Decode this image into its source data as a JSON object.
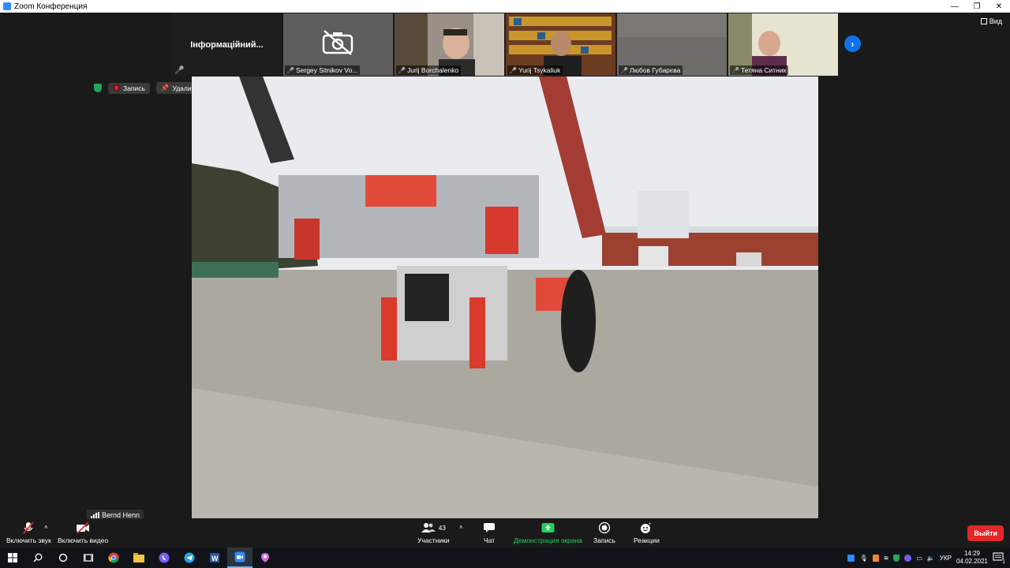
{
  "window": {
    "title": "Zoom Конференция"
  },
  "info_tile": {
    "label": "Інформаційний..."
  },
  "participants": [
    {
      "name": "Sergey Sitnikov Vo...",
      "video": false
    },
    {
      "name": "Jurij Borchalenko",
      "video": true
    },
    {
      "name": "Yurij Tsykaliuk",
      "video": true
    },
    {
      "name": "Любов Губарєва",
      "video": true
    },
    {
      "name": "Тетяна Ситник",
      "video": true
    }
  ],
  "view_button": {
    "label": "Вид"
  },
  "status": {
    "recording": "Запись",
    "unpin": "Удалить закрепление"
  },
  "active_speaker": {
    "name": "Bernd Henn"
  },
  "toolbar": {
    "audio": "Включить звук",
    "video": "Включить видео",
    "participants_label": "Участники",
    "participants_count": "43",
    "chat": "Чат",
    "share": "Демонстрация экрана",
    "record": "Запись",
    "reactions": "Реакции",
    "leave": "Выйти"
  },
  "system_tray": {
    "language": "УКР",
    "time": "14:29",
    "date": "04.02.2021",
    "notifications": "1"
  },
  "colors": {
    "accent": "#0e72ed",
    "danger": "#e02828",
    "share_green": "#23d160",
    "background": "#1a1a1a"
  }
}
